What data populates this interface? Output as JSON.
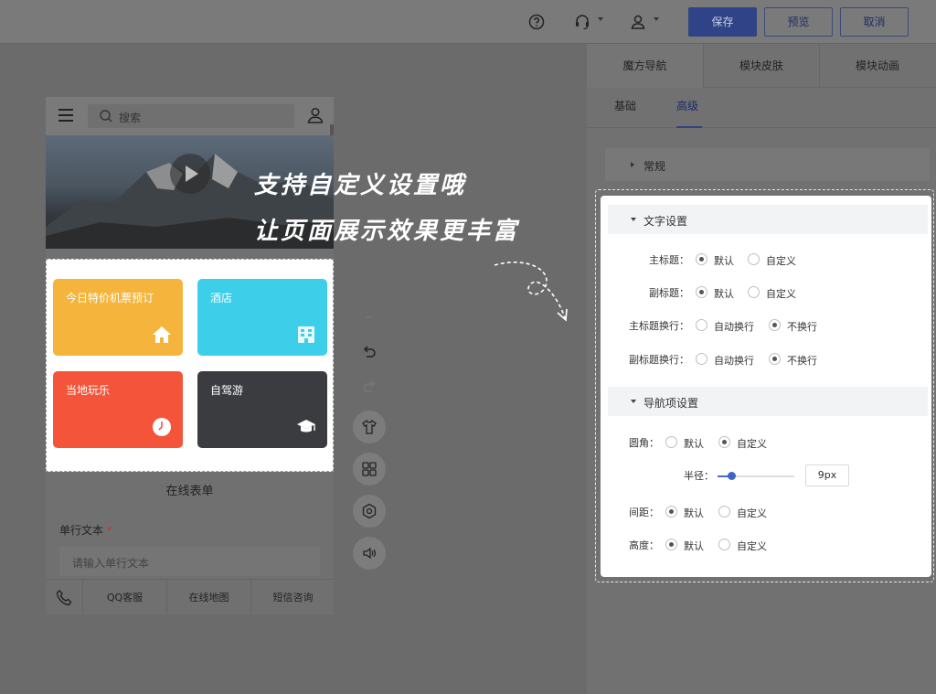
{
  "topbar": {
    "help_icon": "help-circle-icon",
    "support_icon": "headset-icon",
    "user_icon": "user-icon",
    "save_label": "保存",
    "preview_label": "预览",
    "cancel_label": "取消"
  },
  "phone": {
    "search_placeholder": "搜索",
    "tiles": [
      {
        "label": "今日特价机票预订",
        "color": "#f5b53c",
        "icon": "home-icon"
      },
      {
        "label": "酒店",
        "color": "#3dcfe9",
        "icon": "building-icon"
      },
      {
        "label": "当地玩乐",
        "color": "#f4553a",
        "icon": "clock-icon"
      },
      {
        "label": "自驾游",
        "color": "#3a3c40",
        "icon": "graduation-cap-icon"
      }
    ],
    "form_title": "在线表单",
    "field_label": "单行文本",
    "field_required": "*",
    "field_placeholder": "请输入单行文本",
    "footer": [
      "QQ客服",
      "在线地图",
      "短信咨询"
    ]
  },
  "caption": {
    "line1": "支持自定义设置哦",
    "line2": "让页面展示效果更丰富"
  },
  "panel": {
    "tabs": [
      "魔方导航",
      "模块皮肤",
      "模块动画"
    ],
    "subtabs": [
      "基础",
      "高级"
    ],
    "general_section": "常规",
    "text_section": "文字设置",
    "nav_section": "导航项设置",
    "rows": {
      "main_title": {
        "label": "主标题：",
        "options": [
          "默认",
          "自定义"
        ]
      },
      "sub_title": {
        "label": "副标题：",
        "options": [
          "默认",
          "自定义"
        ]
      },
      "main_wrap": {
        "label": "主标题换行：",
        "options": [
          "自动换行",
          "不换行"
        ]
      },
      "sub_wrap": {
        "label": "副标题换行：",
        "options": [
          "自动换行",
          "不换行"
        ]
      },
      "corner": {
        "label": "圆角：",
        "options": [
          "默认",
          "自定义"
        ]
      },
      "radius": {
        "label": "半径：",
        "value": "9px",
        "slider_fraction": 0.18
      },
      "spacing": {
        "label": "间距：",
        "options": [
          "默认",
          "自定义"
        ]
      },
      "height": {
        "label": "高度：",
        "options": [
          "默认",
          "自定义"
        ]
      }
    }
  }
}
